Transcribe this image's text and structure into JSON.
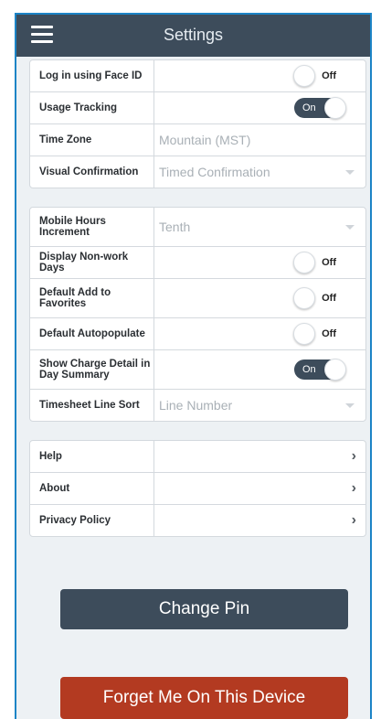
{
  "header": {
    "title": "Settings",
    "menu_icon": "hamburger-icon"
  },
  "group1": [
    {
      "label": "Log in using Face ID",
      "type": "toggle",
      "state": "Off"
    },
    {
      "label": "Usage Tracking",
      "type": "toggle",
      "state": "On"
    },
    {
      "label": "Time Zone",
      "type": "text",
      "value": "Mountain (MST)"
    },
    {
      "label": "Visual Confirmation",
      "type": "select",
      "value": "Timed Confirmation"
    }
  ],
  "group2": [
    {
      "label": "Mobile Hours Increment",
      "type": "select",
      "value": "Tenth"
    },
    {
      "label": "Display Non-work Days",
      "type": "toggle",
      "state": "Off"
    },
    {
      "label": "Default Add to Favorites",
      "type": "toggle",
      "state": "Off"
    },
    {
      "label": "Default Autopopulate",
      "type": "toggle",
      "state": "Off"
    },
    {
      "label": "Show Charge Detail in Day Summary",
      "type": "toggle",
      "state": "On"
    },
    {
      "label": "Timesheet Line Sort",
      "type": "select",
      "value": "Line Number"
    }
  ],
  "group3": [
    {
      "label": "Help",
      "type": "link",
      "icon": "chevron-right-icon"
    },
    {
      "label": "About",
      "type": "link",
      "icon": "chevron-right-icon"
    },
    {
      "label": "Privacy Policy",
      "type": "link",
      "icon": "chevron-right-icon"
    }
  ],
  "buttons": {
    "change_pin": "Change Pin",
    "forget_device": "Forget Me On This Device"
  },
  "colors": {
    "header_bg": "#3d4c5b",
    "page_bg": "#edf1f4",
    "toggle_on": "#3d4c5b",
    "forget_button": "#b33a21"
  }
}
